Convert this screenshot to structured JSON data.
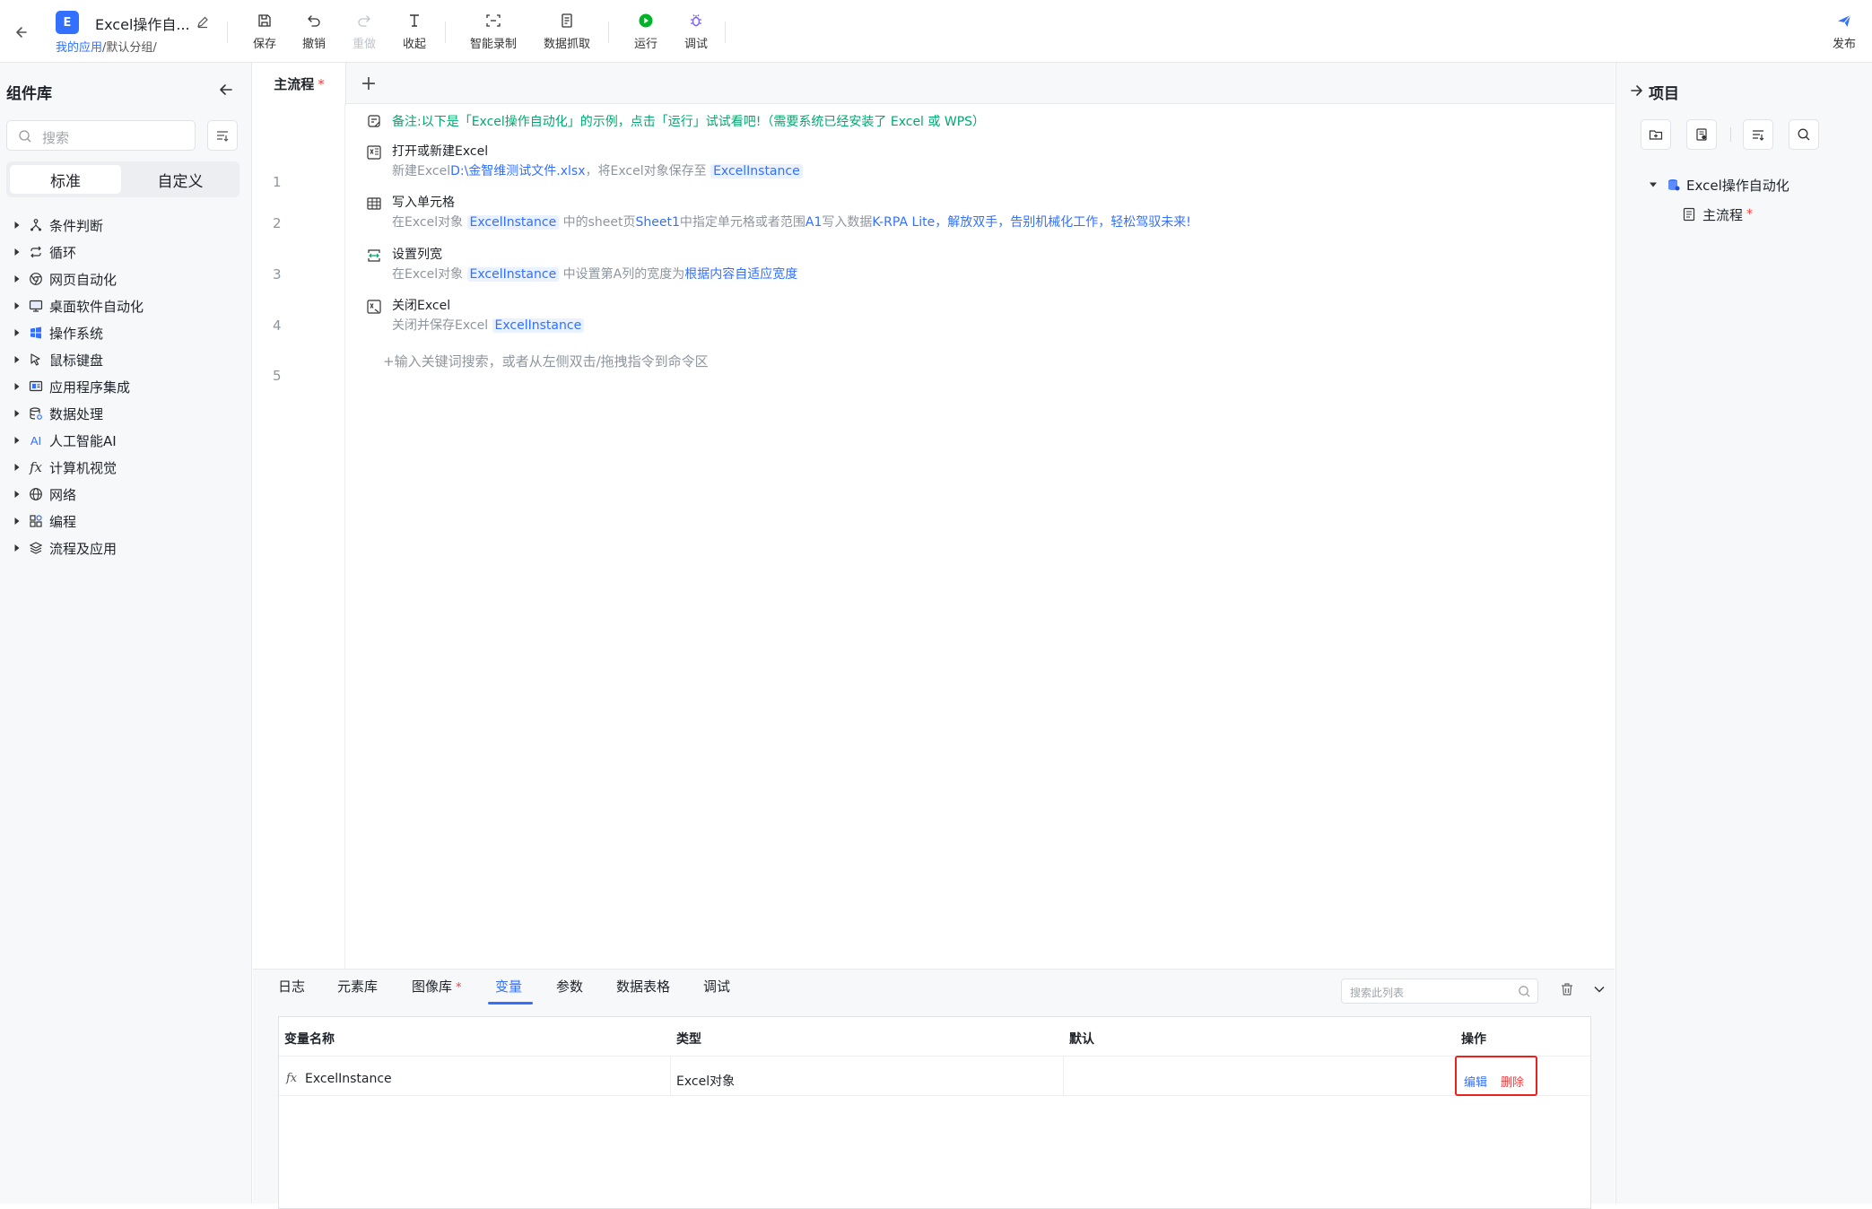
{
  "header": {
    "app_badge": "E",
    "app_title": "Excel操作自...",
    "breadcrumb_link": "我的应用",
    "breadcrumb_rest": "/默认分组/",
    "toolbar": {
      "save": "保存",
      "undo": "撤销",
      "redo": "重做",
      "collapse": "收起",
      "smart_record": "智能录制",
      "data_scrape": "数据抓取",
      "run": "运行",
      "debug": "调试",
      "publish": "发布"
    }
  },
  "left_panel": {
    "title": "组件库",
    "search_placeholder": "搜索",
    "tabs": [
      "标准",
      "自定义"
    ],
    "categories": [
      {
        "label": "条件判断",
        "icon": "branch-icon"
      },
      {
        "label": "循环",
        "icon": "loop-icon"
      },
      {
        "label": "网页自动化",
        "icon": "browser-icon"
      },
      {
        "label": "桌面软件自动化",
        "icon": "desktop-icon"
      },
      {
        "label": "操作系统",
        "icon": "windows-icon"
      },
      {
        "label": "鼠标键盘",
        "icon": "cursor-icon"
      },
      {
        "label": "应用程序集成",
        "icon": "app-integration-icon"
      },
      {
        "label": "数据处理",
        "icon": "database-icon"
      },
      {
        "label": "人工智能AI",
        "icon": "ai-icon",
        "icon_text": "AI"
      },
      {
        "label": "计算机视觉",
        "icon": "function-icon",
        "icon_text": "fx"
      },
      {
        "label": "网络",
        "icon": "globe-icon"
      },
      {
        "label": "编程",
        "icon": "code-blocks-icon"
      },
      {
        "label": "流程及应用",
        "icon": "layers-icon"
      }
    ]
  },
  "editor": {
    "tab_label": "主流程",
    "tab_modified_mark": "*",
    "add_tab": "+",
    "line_numbers": [
      "1",
      "2",
      "3",
      "4",
      "5"
    ],
    "note": "备注:以下是「Excel操作自动化」的示例，点击「运行」试试看吧!（需要系统已经安装了 Excel 或 WPS）",
    "steps": [
      {
        "title": "打开或新建Excel",
        "desc_1": "新建Excel",
        "path": "D:\\金智维测试文件.xlsx",
        "desc_2": "，将Excel对象保存至",
        "var": "ExcelInstance"
      },
      {
        "title": "写入单元格",
        "desc_1": "在Excel对象",
        "var": "ExcelInstance",
        "desc_2": "中的sheet页",
        "sheet": "Sheet1",
        "desc_3": "中指定单元格或者范围",
        "cell": "A1",
        "desc_4": "写入数据",
        "data": "K-RPA Lite，解放双手，告别机械化工作，轻松驾驭未来!"
      },
      {
        "title": "设置列宽",
        "desc_1": "在Excel对象",
        "var": "ExcelInstance",
        "desc_2": "中设置第",
        "col": "A",
        "desc_3": "列的宽度为",
        "mode": "根据内容自适应宽度"
      },
      {
        "title": "关闭Excel",
        "desc_1": "关闭并保存Excel",
        "var": "ExcelInstance"
      }
    ],
    "input_hint": "+输入关键词搜索，或者从左侧双击/拖拽指令到命令区"
  },
  "right_panel": {
    "title": "项目",
    "project_name": "Excel操作自动化",
    "flow_name": "主流程",
    "flow_modified_mark": "*"
  },
  "bottom_panel": {
    "tabs": [
      "日志",
      "元素库",
      "图像库",
      "变量",
      "参数",
      "数据表格",
      "调试"
    ],
    "image_lib_mark": "*",
    "active_tab": "变量",
    "search_placeholder": "搜索此列表",
    "table": {
      "headers": [
        "变量名称",
        "类型",
        "默认",
        "操作"
      ],
      "rows": [
        {
          "name": "ExcelInstance",
          "type": "Excel对象",
          "default": "",
          "edit": "编辑",
          "delete": "删除"
        }
      ]
    }
  },
  "colors": {
    "accent": "#3370ff",
    "note_green": "#00a870",
    "danger": "#f53f3f",
    "highlight_box": "#e8231f"
  }
}
